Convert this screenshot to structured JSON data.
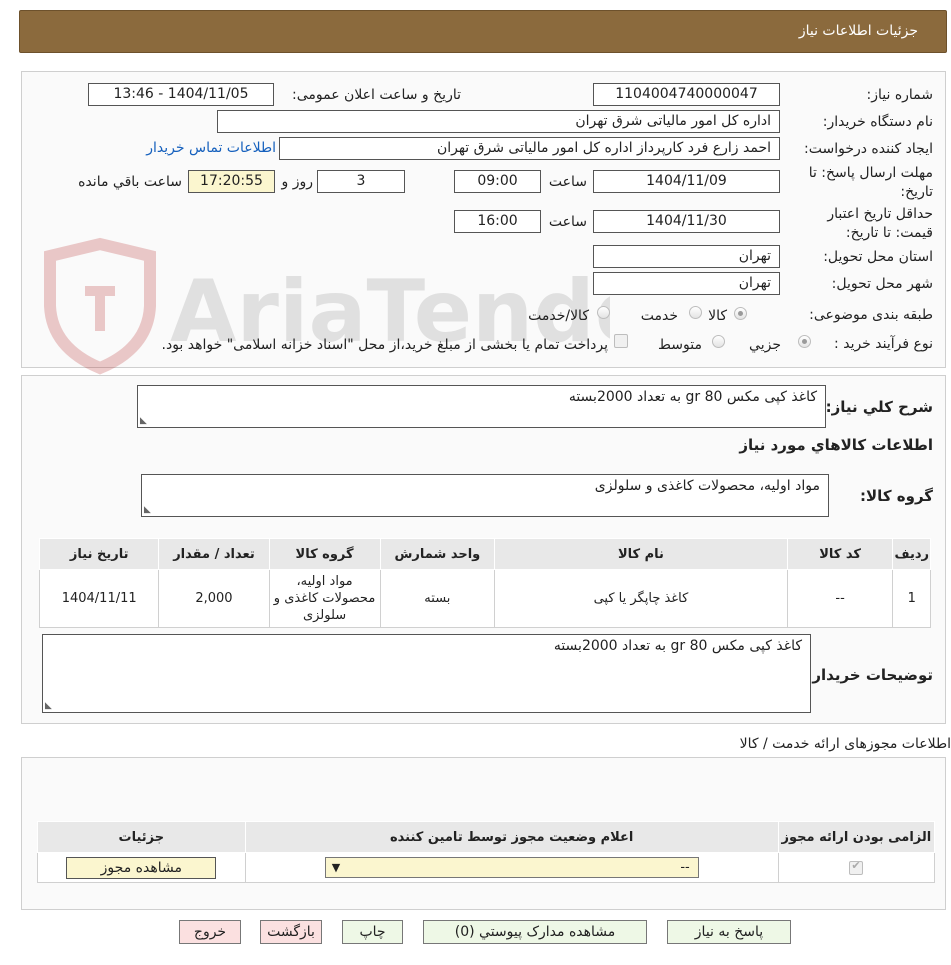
{
  "header": {
    "title": "جزئیات اطلاعات نیاز"
  },
  "form": {
    "need_number_label": "شماره نیاز:",
    "need_number": "1104004740000047",
    "announce_label": "تاریخ و ساعت اعلان عمومی:",
    "announce_value": "1404/11/05 - 13:46",
    "buyer_org_label": "نام دستگاه خریدار:",
    "buyer_org": "اداره کل امور مالیاتی شرق تهران",
    "creator_label": "ایجاد کننده درخواست:",
    "creator": "احمد  زارع فرد کارپرداز اداره کل امور مالیاتی شرق تهران",
    "contact_link": "اطلاعات تماس خریدار",
    "deadline_label": "مهلت ارسال پاسخ: تا تاریخ:",
    "deadline_date": "1404/11/09",
    "time_label": "ساعت",
    "deadline_time": "09:00",
    "days_value": "3",
    "days_label": "روز و",
    "remaining_time": "17:20:55",
    "remaining_label": "ساعت باقي مانده",
    "validity_label": "حداقل تاریخ اعتبار قیمت: تا تاریخ:",
    "validity_date": "1404/11/30",
    "validity_time": "16:00",
    "province_label": "استان محل تحویل:",
    "province": "تهران",
    "city_label": "شهر محل تحویل:",
    "city": "تهران",
    "category_label": "طبقه بندی موضوعی:",
    "category_options": [
      "کالا",
      "خدمت",
      "کالا/خدمت"
    ],
    "process_label": "نوع فرآیند خرید :",
    "process_options": [
      "جزیي",
      "متوسط"
    ],
    "payment_note": "پرداخت تمام یا بخشی از مبلغ خرید،از محل \"اسناد خزانه اسلامی\" خواهد بود."
  },
  "watermark": "AriaTender.neT",
  "general": {
    "desc_label": "شرح کلي نياز:",
    "desc_value": "کاغذ کپی مکس 80 gr به تعداد 2000بسته",
    "goods_info_title": "اطلاعات کالاهاي مورد نياز",
    "group_label": "گروه کالا:",
    "group_value": "مواد اولیه، محصولات کاغذی و سلولزی"
  },
  "items_table": {
    "headers": [
      "ردیف",
      "کد کالا",
      "نام کالا",
      "واحد شمارش",
      "گروه کالا",
      "تعداد / مقدار",
      "تاریخ نیاز"
    ],
    "rows": [
      [
        "1",
        "--",
        "کاغذ چاپگر یا کپی",
        "بسته",
        "مواد اولیه، محصولات کاغذی و سلولزی",
        "2,000",
        "1404/11/11"
      ]
    ]
  },
  "buyer_notes": {
    "label": "توضیحات خریدار:",
    "value": "کاغذ کپی مکس 80 gr به تعداد 2000بسته"
  },
  "permits": {
    "title": "اطلاعات مجوزهای ارائه خدمت / کالا",
    "headers": [
      "الزامی بودن ارائه مجوز",
      "اعلام وضعیت مجوز توسط تامین کننده",
      "جزئیات"
    ],
    "select_value": "--",
    "view_button": "مشاهده مجوز"
  },
  "buttons": {
    "reply": "پاسخ به نیاز",
    "attachments": "مشاهده مدارک پیوستي (0)",
    "print": "چاپ",
    "back": "بازگشت",
    "exit": "خروج"
  }
}
